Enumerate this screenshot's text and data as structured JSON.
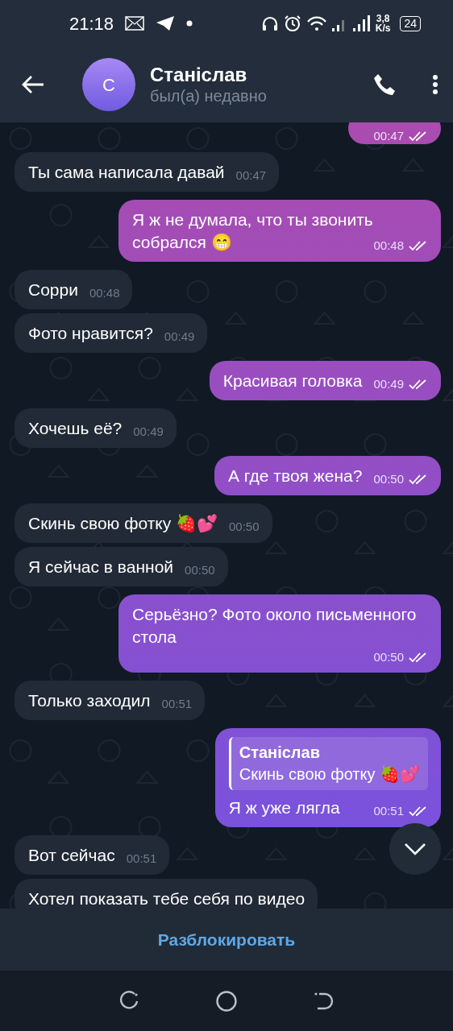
{
  "status_bar": {
    "time": "21:18",
    "speed_value": "3,8",
    "speed_unit": "K/s",
    "battery": "24"
  },
  "header": {
    "avatar_letter": "С",
    "name": "Станіслав",
    "status": "был(а) недавно"
  },
  "messages": [
    {
      "outgoing": true,
      "time": "00:47",
      "read": true
    },
    {
      "outgoing": false,
      "text": "Ты сама написала давай",
      "time": "00:47"
    },
    {
      "outgoing": true,
      "text": "Я ж не думала, что ты звонить собрался 😁",
      "time": "00:48",
      "read": true
    },
    {
      "outgoing": false,
      "text": "Сорри",
      "time": "00:48"
    },
    {
      "outgoing": false,
      "text": "Фото нравится?",
      "time": "00:49"
    },
    {
      "outgoing": true,
      "text": "Красивая головка",
      "time": "00:49",
      "read": true
    },
    {
      "outgoing": false,
      "text": "Хочешь её?",
      "time": "00:49"
    },
    {
      "outgoing": true,
      "text": "А где твоя жена?",
      "time": "00:50",
      "read": true
    },
    {
      "outgoing": false,
      "text": "Скинь свою фотку 🍓💕",
      "time": "00:50"
    },
    {
      "outgoing": false,
      "text": "Я сейчас в ванной",
      "time": "00:50"
    },
    {
      "outgoing": true,
      "text": "Серьёзно? Фото около письменного стола",
      "time": "00:50",
      "read": true
    },
    {
      "outgoing": false,
      "text": "Только заходил",
      "time": "00:51"
    },
    {
      "outgoing": true,
      "reply": {
        "author": "Станіслав",
        "text": "Скинь свою фотку 🍓💕"
      },
      "text": "Я ж уже лягла",
      "time": "00:51",
      "read": true
    },
    {
      "outgoing": false,
      "text": "Вот сейчас",
      "time": "00:51"
    },
    {
      "outgoing": false,
      "text": "Хотел показать тебе себя по видео"
    }
  ],
  "unblock_button": "Разблокировать"
}
